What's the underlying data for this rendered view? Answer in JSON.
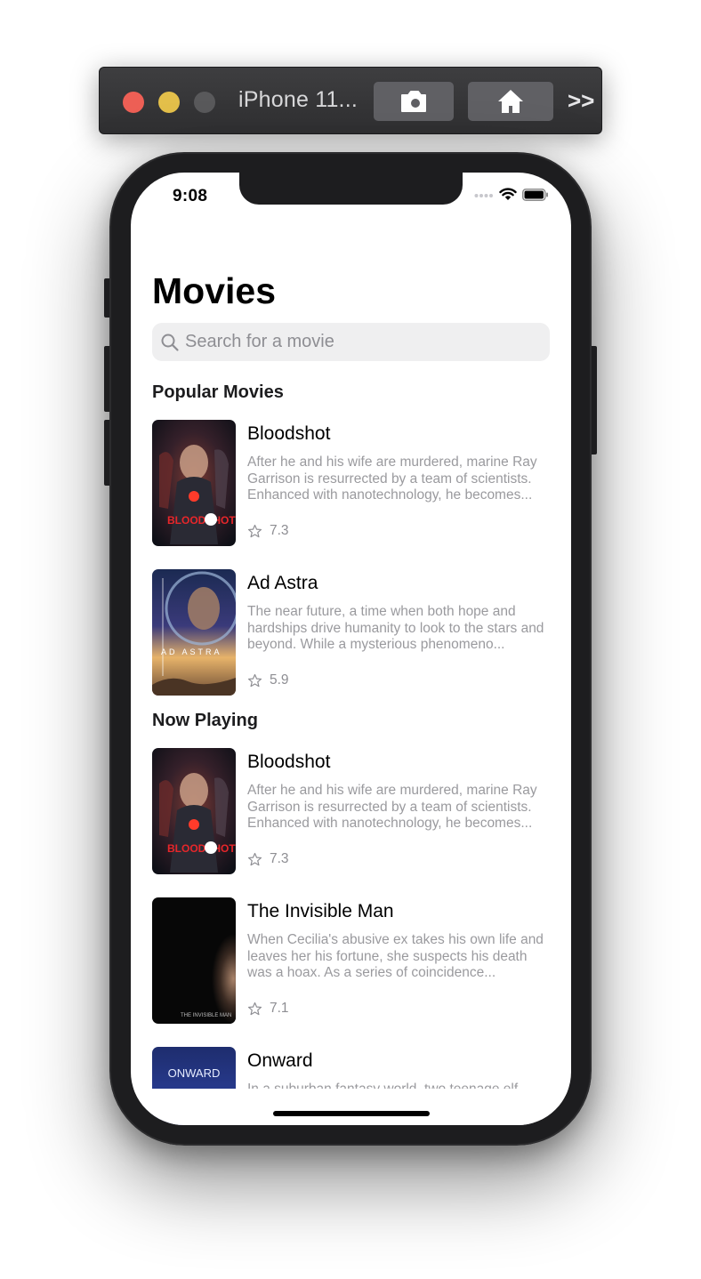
{
  "simulator": {
    "title": "iPhone 11...",
    "more_label": ">>"
  },
  "status_bar": {
    "time": "9:08"
  },
  "page": {
    "title": "Movies"
  },
  "search": {
    "placeholder": "Search for a movie"
  },
  "sections": [
    {
      "title": "Popular Movies",
      "movies": [
        {
          "title": "Bloodshot",
          "overview": "After he and his wife are murdered, marine Ray Garrison is resurrected by a team of scientists. Enhanced with nanotechnology, he becomes...",
          "rating": "7.3",
          "poster_text": "BLOODSHOT"
        },
        {
          "title": "Ad Astra",
          "overview": "The near future, a time when both hope and hardships drive humanity to look to the stars and beyond. While a mysterious phenomeno...",
          "rating": "5.9",
          "poster_text": "AD ASTRA"
        }
      ]
    },
    {
      "title": "Now Playing",
      "movies": [
        {
          "title": "Bloodshot",
          "overview": "After he and his wife are murdered, marine Ray Garrison is resurrected by a team of scientists. Enhanced with nanotechnology, he becomes...",
          "rating": "7.3",
          "poster_text": "BLOODSHOT"
        },
        {
          "title": "The Invisible Man",
          "overview": "When Cecilia's abusive ex takes his own life and leaves her his fortune, she suspects his death was a hoax. As a series of coincidence...",
          "rating": "7.1",
          "poster_text": "THE INVISIBLE MAN"
        },
        {
          "title": "Onward",
          "overview": "In a suburban fantasy world, two teenage elf",
          "poster_text": "ONWARD"
        }
      ]
    }
  ],
  "colors": {
    "accent_placeholder": "#8e8e93",
    "overview_text": "#9a9a9e",
    "search_bg": "#efeff0"
  }
}
